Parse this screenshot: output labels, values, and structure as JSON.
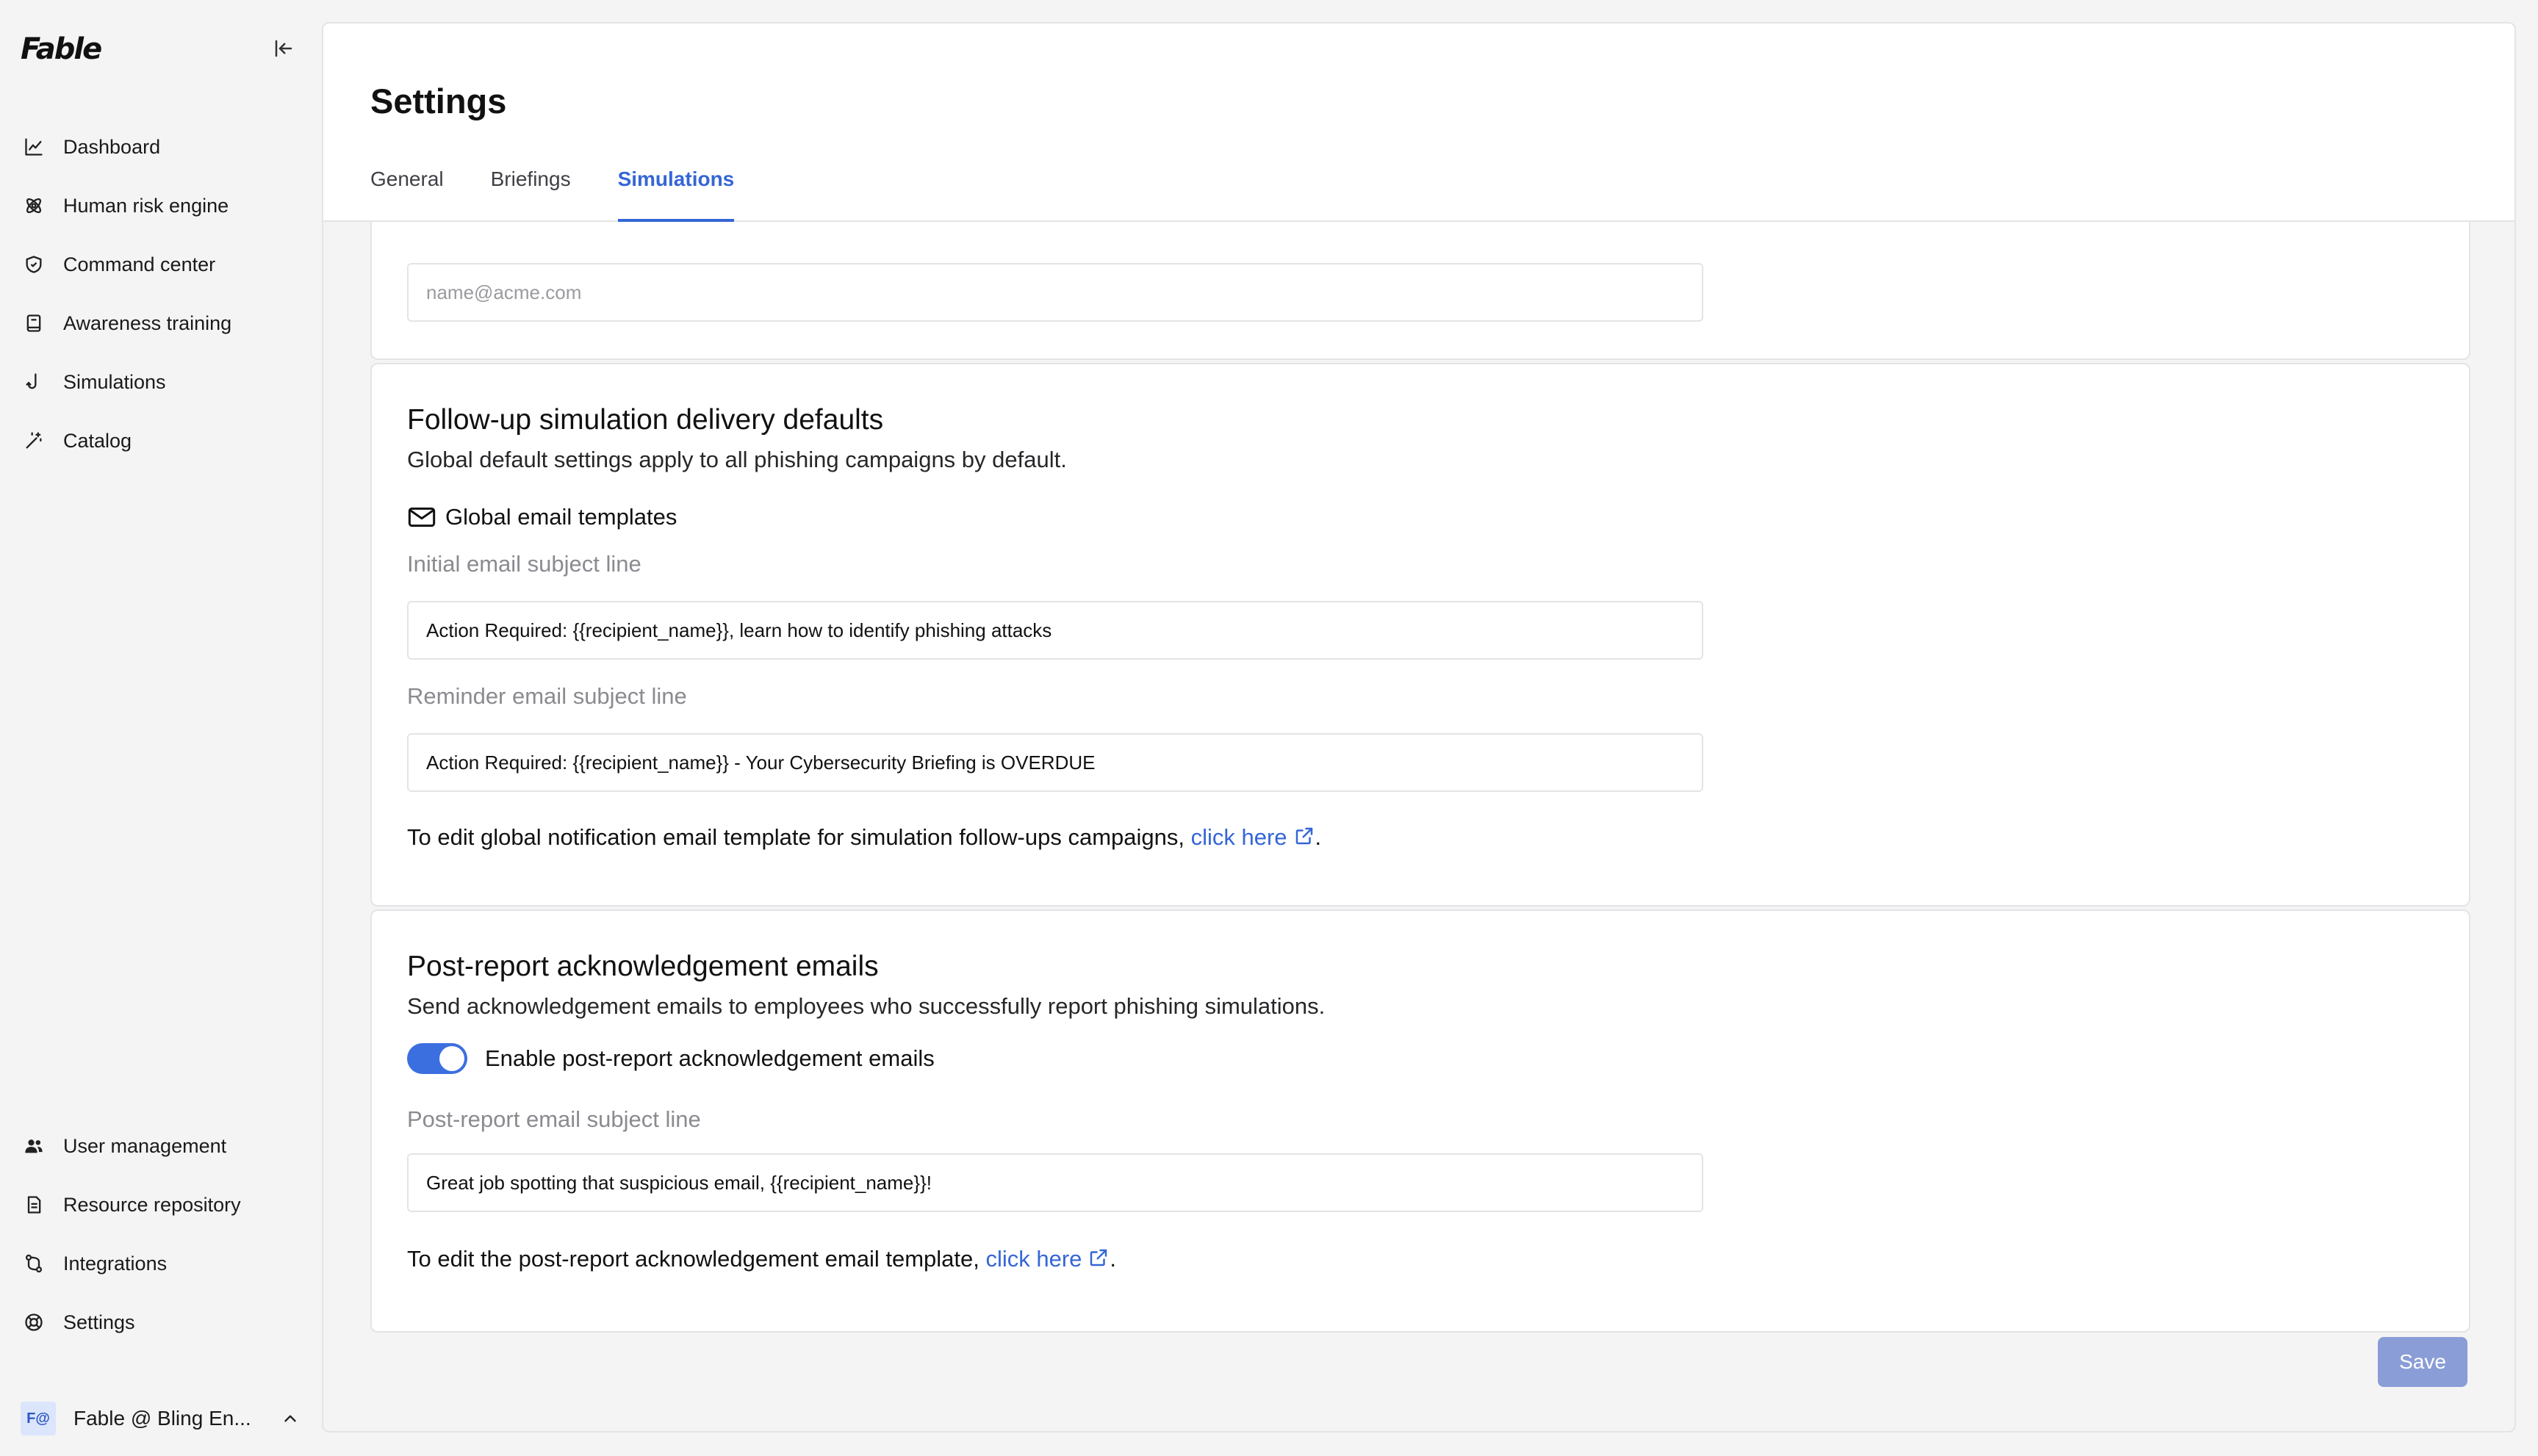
{
  "app": {
    "logo": "Fable"
  },
  "sidebar": {
    "top_items": [
      {
        "label": "Dashboard",
        "icon": "chart-line-icon"
      },
      {
        "label": "Human risk engine",
        "icon": "atom-icon"
      },
      {
        "label": "Command center",
        "icon": "shield-icon"
      },
      {
        "label": "Awareness training",
        "icon": "book-icon"
      },
      {
        "label": "Simulations",
        "icon": "fishhook-icon"
      },
      {
        "label": "Catalog",
        "icon": "magic-wand-icon"
      }
    ],
    "bottom_items": [
      {
        "label": "User management",
        "icon": "users-icon"
      },
      {
        "label": "Resource repository",
        "icon": "document-icon"
      },
      {
        "label": "Integrations",
        "icon": "git-compare-icon"
      },
      {
        "label": "Settings",
        "icon": "lifebuoy-icon"
      }
    ],
    "workspace": {
      "avatar": "F@",
      "name": "Fable @ Bling En..."
    }
  },
  "header": {
    "title": "Settings",
    "tabs": [
      {
        "label": "General",
        "active": false
      },
      {
        "label": "Briefings",
        "active": false
      },
      {
        "label": "Simulations",
        "active": true
      }
    ]
  },
  "sender": {
    "placeholder": "name@acme.com"
  },
  "followup": {
    "title": "Follow-up simulation delivery defaults",
    "description": "Global default settings apply to all phishing campaigns by default.",
    "templates_heading": "Global email templates",
    "initial_label": "Initial email subject line",
    "initial_value": "Action Required: {{recipient_name}}, learn how to identify phishing attacks",
    "reminder_label": "Reminder email subject line",
    "reminder_value": "Action Required: {{recipient_name}} - Your Cybersecurity Briefing is OVERDUE",
    "help_prefix": "To edit global notification email template for simulation follow-ups campaigns, ",
    "help_link": "click here",
    "help_suffix": "."
  },
  "post_report": {
    "title": "Post-report acknowledgement emails",
    "description": "Send acknowledgement emails to employees who successfully report phishing simulations.",
    "toggle_label": "Enable post-report acknowledgement emails",
    "toggle_on": true,
    "subject_label": "Post-report email subject line",
    "subject_value": "Great job spotting that suspicious email, {{recipient_name}}!",
    "help_prefix": "To edit the post-report acknowledgement email template, ",
    "help_link": "click here",
    "help_suffix": "."
  },
  "actions": {
    "save_label": "Save"
  },
  "colors": {
    "accent": "#3566d6",
    "toggle": "#3b6fe0",
    "save_disabled": "#8a9dd6"
  }
}
